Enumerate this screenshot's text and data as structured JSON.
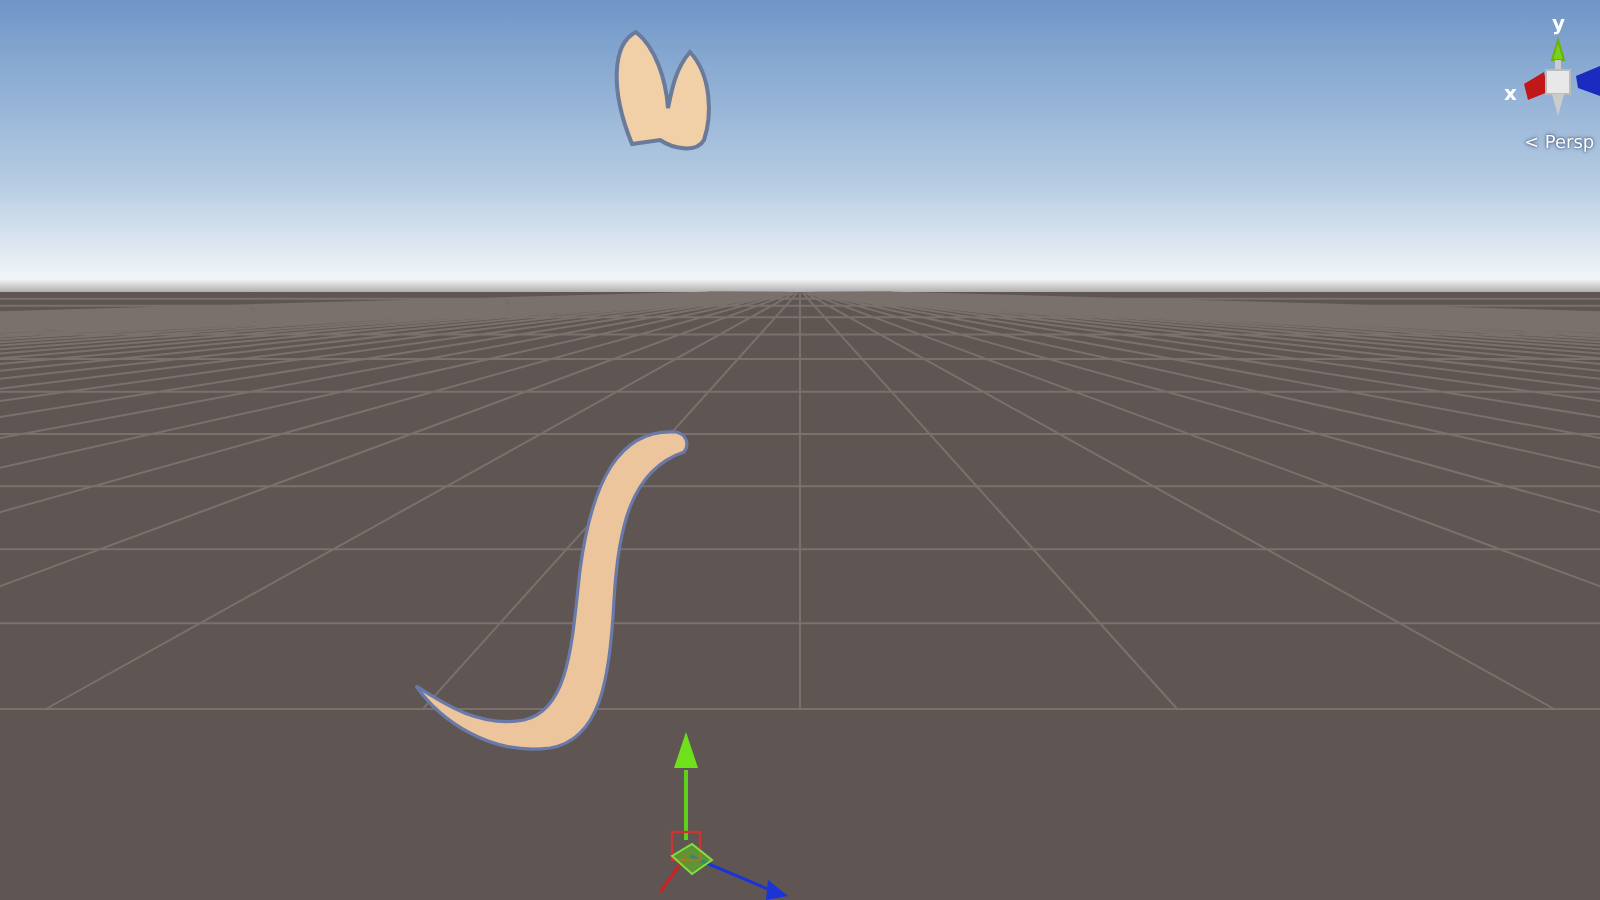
{
  "scene_gizmo": {
    "y_label": "y",
    "x_label": "x",
    "projection": "< Persp"
  }
}
